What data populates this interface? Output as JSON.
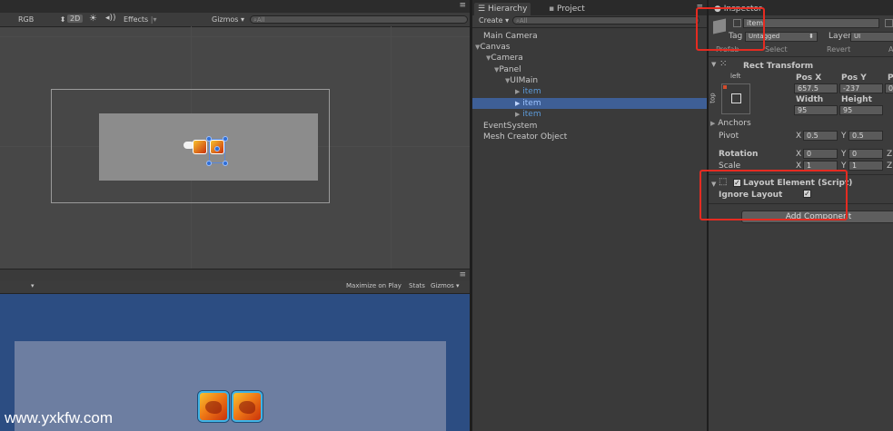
{
  "scene": {
    "color_mode": "RGB",
    "mode_2d": "2D",
    "sun_icon": "sun-icon",
    "audio_icon": "speaker-icon",
    "effects_label": "Effects",
    "gizmos_label": "Gizmos",
    "search_placeholder": "All"
  },
  "game": {
    "maximize_label": "Maximize on Play",
    "stats_label": "Stats",
    "gizmos_label": "Gizmos"
  },
  "hierarchy": {
    "tab_label": "Hierarchy",
    "project_tab_label": "Project",
    "create_label": "Create",
    "search_placeholder": "All",
    "items": [
      {
        "label": "Main Camera"
      },
      {
        "label": "Canvas"
      },
      {
        "label": "Camera"
      },
      {
        "label": "Panel"
      },
      {
        "label": "UIMain"
      },
      {
        "label": "item"
      },
      {
        "label": "item"
      },
      {
        "label": "item"
      },
      {
        "label": "EventSystem"
      },
      {
        "label": "Mesh Creator Object"
      }
    ]
  },
  "inspector": {
    "tab_label": "Inspector",
    "object_name": "item",
    "tag_label": "Tag",
    "tag_value": "Untagged",
    "layer_label": "Layer",
    "layer_value": "UI",
    "prefab_label": "Prefab",
    "select_label": "Select",
    "revert_label": "Revert",
    "apply_label": "A",
    "rect_transform": {
      "title": "Rect Transform",
      "anchor_h": "left",
      "anchor_v": "top",
      "pos_x_label": "Pos X",
      "pos_y_label": "Pos Y",
      "pos_z_label": "P",
      "pos_x": "657.5",
      "pos_y": "-237",
      "pos_z": "0",
      "width_label": "Width",
      "height_label": "Height",
      "width": "95",
      "height": "95",
      "anchors_label": "Anchors",
      "pivot_label": "Pivot",
      "pivot_x_label": "X",
      "pivot_x": "0.5",
      "pivot_y_label": "Y",
      "pivot_y": "0.5",
      "rotation_label": "Rotation",
      "rot_x_label": "X",
      "rot_x": "0",
      "rot_y_label": "Y",
      "rot_y": "0",
      "rot_z_label": "Z",
      "scale_label": "Scale",
      "scale_x_label": "X",
      "scale_x": "1",
      "scale_y_label": "Y",
      "scale_y": "1",
      "scale_z_label": "Z"
    },
    "layout_element": {
      "title": "Layout Element (Script)",
      "ignore_layout_label": "Ignore Layout"
    },
    "add_component_label": "Add Component"
  },
  "watermark": "www.yxkfw.com"
}
